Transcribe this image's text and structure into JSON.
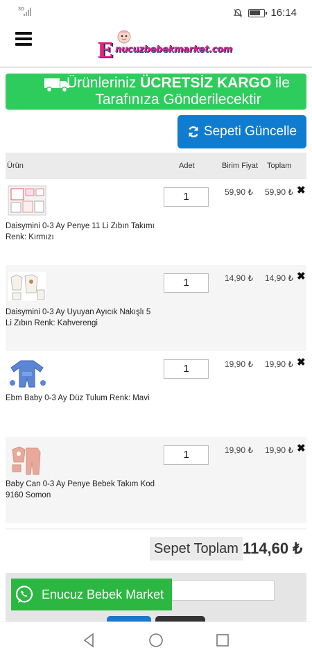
{
  "status_bar": {
    "network": "3G",
    "time": "16:14"
  },
  "header": {
    "logo_letter": "E",
    "logo_text": "nucuzbebekmarket.com"
  },
  "banner": {
    "text_before": "Ürünleriniz ",
    "text_bold": "ÜCRETSİZ KARGO",
    "text_after": " ile Tarafınıza Gönderilecektir"
  },
  "update_button": {
    "label": "Sepeti Güncelle"
  },
  "table": {
    "headers": {
      "product": "Ürün",
      "qty": "Adet",
      "unit_price": "Birim Fiyat",
      "total": "Toplam"
    },
    "rows": [
      {
        "name": "Daisymini 0-3 Ay Penye 11 Li Zıbın Takımı Renk: Kırmızı",
        "qty": "1",
        "price": "59,90 ₺",
        "total": "59,90 ₺",
        "remove": "✖"
      },
      {
        "name": "Daisymini 0-3 Ay Uyuyan Ayıcık Nakışlı 5 Li Zıbın Renk: Kahverengi",
        "qty": "1",
        "price": "14,90 ₺",
        "total": "14,90 ₺",
        "remove": "✖"
      },
      {
        "name": "Ebm Baby 0-3 Ay Düz Tulum Renk: Mavi",
        "qty": "1",
        "price": "19,90 ₺",
        "total": "19,90 ₺",
        "remove": "✖"
      },
      {
        "name": "Baby Can 0-3 Ay Penye Bebek Takım Kod 9160 Somon",
        "qty": "1",
        "price": "19,90 ₺",
        "total": "19,90 ₺",
        "remove": "✖"
      }
    ]
  },
  "cart_total": {
    "label": "Sepet Toplam",
    "value": "114,60 ₺"
  },
  "whatsapp": {
    "label": "Enucuz Bebek Market"
  },
  "colors": {
    "green": "#2ecc5c",
    "blue": "#0f7ccf",
    "whatsapp": "#2bb741",
    "brand_pink": "#e8207a"
  }
}
